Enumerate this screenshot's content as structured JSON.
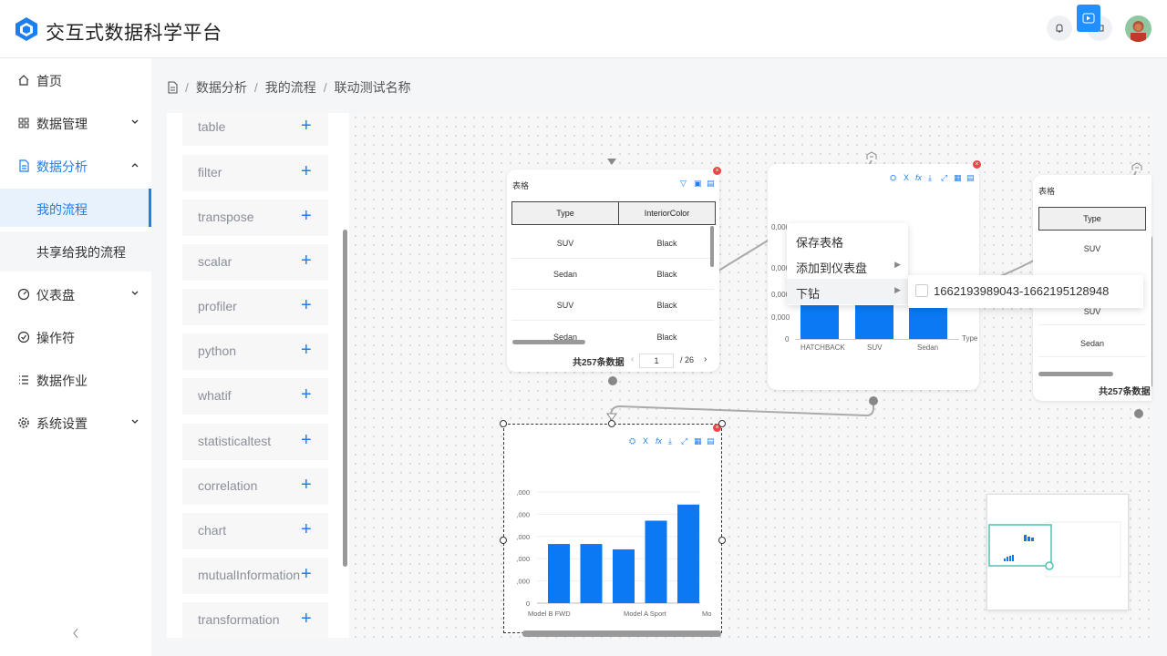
{
  "app": {
    "title": "交互式数据科学平台",
    "accent": "#1e7ef0"
  },
  "header": {
    "icons": [
      "bell-icon",
      "screen-icon",
      "play-icon",
      "avatar"
    ]
  },
  "sidebar": {
    "items": [
      {
        "label": "首页",
        "icon": "home-icon"
      },
      {
        "label": "数据管理",
        "icon": "grid-icon"
      },
      {
        "label": "数据分析",
        "icon": "document-icon"
      },
      {
        "label": "我的流程"
      },
      {
        "label": "共享给我的流程"
      },
      {
        "label": "仪表盘",
        "icon": "dashboard-icon"
      },
      {
        "label": "操作符",
        "icon": "check-circle-icon"
      },
      {
        "label": "数据作业",
        "icon": "list-icon"
      },
      {
        "label": "系统设置",
        "icon": "gear-icon"
      }
    ]
  },
  "breadcrumb": {
    "items": [
      "数据分析",
      "我的流程",
      "联动测试名称"
    ]
  },
  "operators": [
    "table",
    "filter",
    "transpose",
    "scalar",
    "profiler",
    "python",
    "whatif",
    "statisticaltest",
    "correlation",
    "chart",
    "mutualInformation",
    "transformation"
  ],
  "table_card": {
    "title": "表格",
    "columns": [
      "Type",
      "InteriorColor"
    ],
    "rows": [
      [
        "SUV",
        "Black"
      ],
      [
        "Sedan",
        "Black"
      ],
      [
        "SUV",
        "Black"
      ],
      [
        "Sedan",
        "Black"
      ]
    ],
    "total": "共257条数据",
    "page": "1",
    "pages": "/ 26"
  },
  "chart_card_top": {
    "y_ticks": [
      "0,000",
      "0,000",
      "0,000",
      "0,000",
      "0"
    ],
    "x_labels": [
      "HATCHBACK",
      "SUV",
      "Sedan",
      "Type"
    ]
  },
  "table_card_right": {
    "title": "表格",
    "column": "Type",
    "rows": [
      "SUV",
      "SUV",
      "Sedan"
    ],
    "total": "共257条数据"
  },
  "context_menu": {
    "items": [
      "保存表格",
      "添加到仪表盘",
      "下钻"
    ],
    "submenu": "1662193989043-1662195128948"
  },
  "chart_data": {
    "type": "bar",
    "y_ticks": [
      ",000",
      ",000",
      ",000",
      ",000",
      ",000",
      "0"
    ],
    "categories": [
      "Model B FWD",
      "",
      "",
      "Model A Sport",
      "",
      "Mo"
    ],
    "values": [
      3.3,
      3.3,
      3.0,
      4.6,
      5.5
    ],
    "ylim": [
      0,
      6.2
    ],
    "color": "#0a79f3"
  }
}
